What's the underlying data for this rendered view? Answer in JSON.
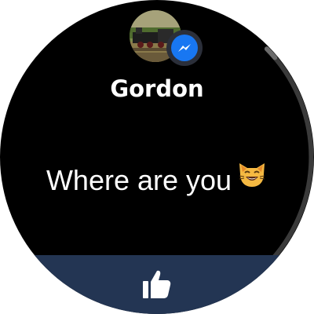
{
  "notification": {
    "sender_name": "Gordon",
    "message_text": "Where are you",
    "message_emoji": "grinning-cat-emoji",
    "app_badge_icon": "messenger-icon"
  },
  "avatar": {
    "description_icon": "avatar-train-photo"
  },
  "reply": {
    "action_icon": "thumbs-up-icon"
  },
  "colors": {
    "background": "#000000",
    "reply_bar": "#233553",
    "messenger_blue": "#1877f2",
    "scroll_thumb": "#6b6b6b",
    "scroll_track": "#3a3a3a"
  }
}
